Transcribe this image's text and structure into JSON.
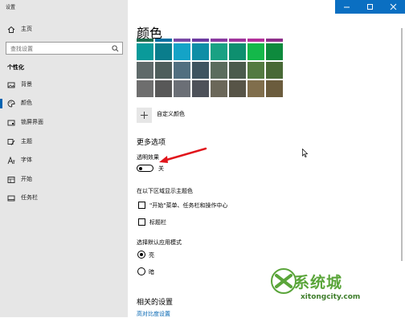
{
  "window": {
    "title": "设置"
  },
  "sidebar": {
    "home_label": "主页",
    "search_placeholder": "查找设置",
    "group_label": "个性化",
    "items": [
      {
        "label": "背景",
        "icon": "picture-icon"
      },
      {
        "label": "颜色",
        "icon": "palette-icon",
        "active": true
      },
      {
        "label": "锁屏界面",
        "icon": "lock-screen-icon"
      },
      {
        "label": "主题",
        "icon": "brush-icon"
      },
      {
        "label": "字体",
        "icon": "font-icon"
      },
      {
        "label": "开始",
        "icon": "start-icon"
      },
      {
        "label": "任务栏",
        "icon": "taskbar-icon"
      }
    ]
  },
  "main": {
    "title": "颜色",
    "swatches": [
      [
        "#0a9a9a",
        "#0a7d8c",
        "#14a3c7",
        "#0f8ea6",
        "#1aa183",
        "#0e8f6f",
        "#14b84a",
        "#0e8a3d"
      ],
      [
        "#5f6a6a",
        "#4e5e5c",
        "#516f80",
        "#3e5460",
        "#5b6c5d",
        "#4b5b4d",
        "#537a41",
        "#486936"
      ],
      [
        "#6e6e6e",
        "#585858",
        "#6b6f76",
        "#4d5159",
        "#6b6759",
        "#575447",
        "#806e4c",
        "#6b5c3d"
      ]
    ],
    "swatch_top_colors": [
      "#1e6b4e",
      "#0b6fa0",
      "#7a4aa6",
      "#6d3aa0",
      "#8a3aa0",
      "#a0359c",
      "#b4309a",
      "#8e2f8a"
    ],
    "custom_color_label": "自定义颜色",
    "more_options_title": "更多选项",
    "transparency_label": "透明效果",
    "transparency_value": "关",
    "accent_surfaces_label": "在以下区域显示主题色",
    "checkbox_start": "\"开始\"菜单、任务栏和操作中心",
    "checkbox_titlebar": "标题栏",
    "default_mode_label": "选择默认应用模式",
    "radio_light": "亮",
    "radio_dark": "暗",
    "related_title": "相关的设置",
    "related_link": "高对比度设置"
  },
  "colors": {
    "accent": "#0063b1",
    "sidebar_bg": "#e6e6e6",
    "titlebar_ctrl": "#0a6fc2",
    "arrow": "#e1141b"
  },
  "watermark": {
    "text": "系统城",
    "subtext": "xitongcity.com"
  }
}
